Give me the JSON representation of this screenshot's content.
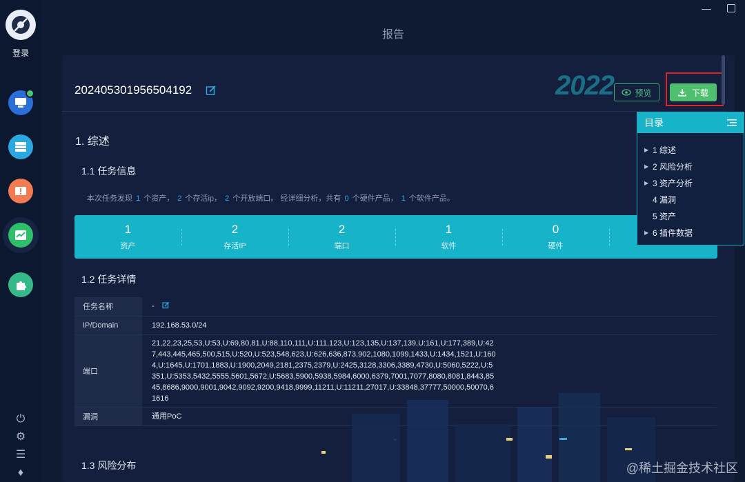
{
  "sidebar": {
    "login_label": "登录"
  },
  "page": {
    "title": "报告"
  },
  "report": {
    "id": "202405301956504192",
    "year_mark": "2022",
    "preview_label": "预览",
    "download_label": "下载"
  },
  "sections": {
    "overview": "1. 综述",
    "task_info": "1.1 任务信息",
    "task_detail": "1.2 任务详情",
    "risk_dist": "1.3 风险分布"
  },
  "summary": {
    "p1": "本次任务发现",
    "n_assets": "1",
    "p2": "个资产，",
    "n_alive": "2",
    "p3": "个存活ip，",
    "n_ports": "2",
    "p4": "个开放端口。 经详细分析，共有",
    "n_hw": "0",
    "p5": "个硬件产品，",
    "n_sw": "1",
    "p6": "个软件产品。"
  },
  "stats": [
    {
      "value": "1",
      "label": "资产"
    },
    {
      "value": "2",
      "label": "存活IP"
    },
    {
      "value": "2",
      "label": "端口"
    },
    {
      "value": "1",
      "label": "软件"
    },
    {
      "value": "0",
      "label": "硬件"
    },
    {
      "value": "",
      "label": ""
    }
  ],
  "details": {
    "task_name_key": "任务名称",
    "task_name_val": "-",
    "ip_key": "IP/Domain",
    "ip_val": "192.168.53.0/24",
    "port_key": "端口",
    "port_val": "21,22,23,25,53,U:53,U:69,80,81,U:88,110,111,U:111,123,U:123,135,U:137,139,U:161,U:177,389,U:427,443,445,465,500,515,U:520,U:523,548,623,U:626,636,873,902,1080,1099,1433,U:1434,1521,U:1604,U:1645,U:1701,1883,U:1900,2049,2181,2375,2379,U:2425,3128,3306,3389,4730,U:5060,5222,U:5351,U:5353,5432,5555,5601,5672,U:5683,5900,5938,5984,6000,6379,7001,7077,8080,8081,8443,8545,8686,9000,9001,9042,9092,9200,9418,9999,11211,U:11211,27017,U:33848,37777,50000,50070,61616",
    "vuln_key": "漏洞",
    "vuln_val": "通用PoC"
  },
  "toc": {
    "title": "目录",
    "items": [
      {
        "label": "1 综述",
        "arrow": true
      },
      {
        "label": "2 风险分析",
        "arrow": true
      },
      {
        "label": "3 资产分析",
        "arrow": true
      },
      {
        "label": "4 漏洞",
        "arrow": false
      },
      {
        "label": "5 资产",
        "arrow": false
      },
      {
        "label": "6 插件数据",
        "arrow": true
      }
    ]
  },
  "watermark": "@稀土掘金技术社区",
  "colors": {
    "accent": "#17b3c9",
    "download": "#4fbf6f",
    "highlight": "#e02424"
  }
}
